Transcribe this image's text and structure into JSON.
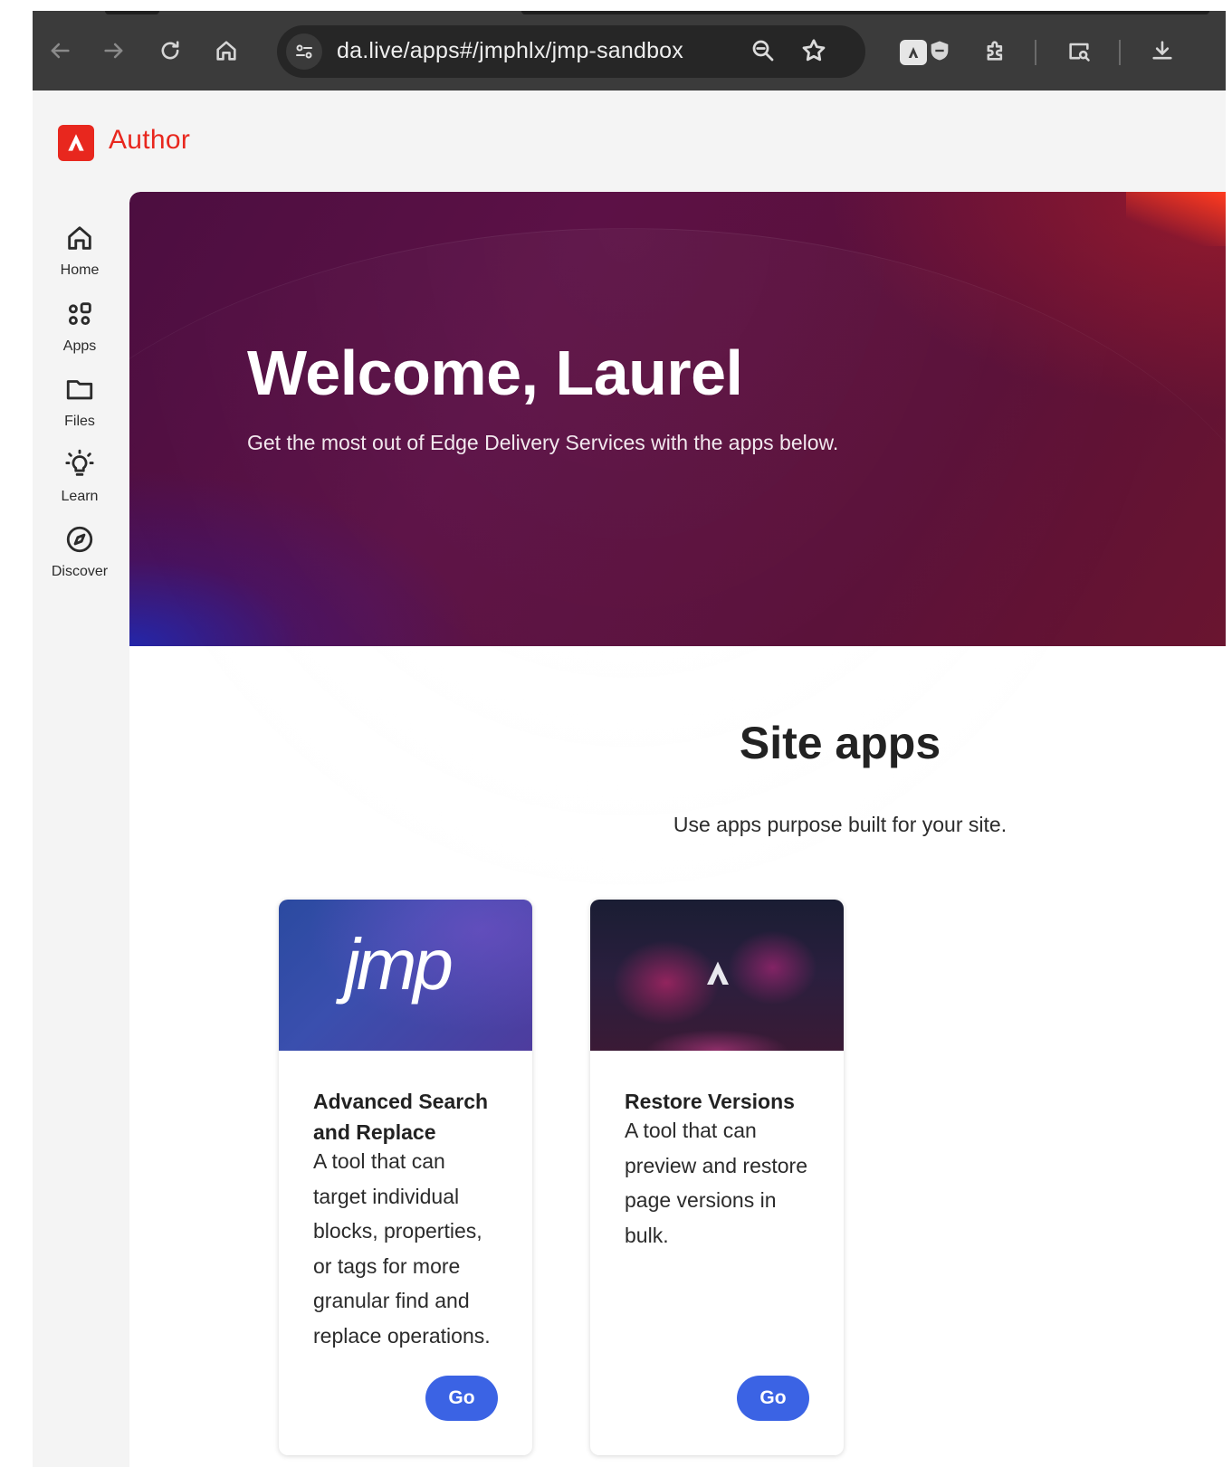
{
  "browser": {
    "url": "da.live/apps#/jmphlx/jmp-sandbox",
    "icons": [
      "back-icon",
      "forward-icon",
      "reload-icon",
      "home-icon",
      "site-info-icon",
      "zoom-icon",
      "bookmark-star-icon",
      "adobe-extension-icon",
      "shield-extension-icon",
      "extensions-puzzle-icon",
      "tab-search-icon",
      "download-icon"
    ]
  },
  "app": {
    "title": "Author",
    "brand_color": "#e8271e"
  },
  "rail": {
    "items": [
      {
        "label": "Home",
        "icon": "home-icon"
      },
      {
        "label": "Apps",
        "icon": "apps-icon"
      },
      {
        "label": "Files",
        "icon": "folder-icon"
      },
      {
        "label": "Learn",
        "icon": "lightbulb-icon"
      },
      {
        "label": "Discover",
        "icon": "compass-icon"
      }
    ]
  },
  "hero": {
    "title": "Welcome, Laurel",
    "subtitle": "Get the most out of Edge Delivery Services with the apps below."
  },
  "section": {
    "title": "Site apps",
    "subtitle": "Use apps purpose built for your site."
  },
  "cards": [
    {
      "title": "Advanced Search and Replace",
      "description": "A tool that can target individual blocks, properties, or tags for more granular find and replace operations.",
      "button": "Go",
      "image_text": "jmp"
    },
    {
      "title": "Restore Versions",
      "description": "A tool that can preview and restore page versions in bulk.",
      "button": "Go"
    }
  ],
  "colors": {
    "accent_button": "#3b63e4",
    "hero_base": "#5a1040"
  }
}
